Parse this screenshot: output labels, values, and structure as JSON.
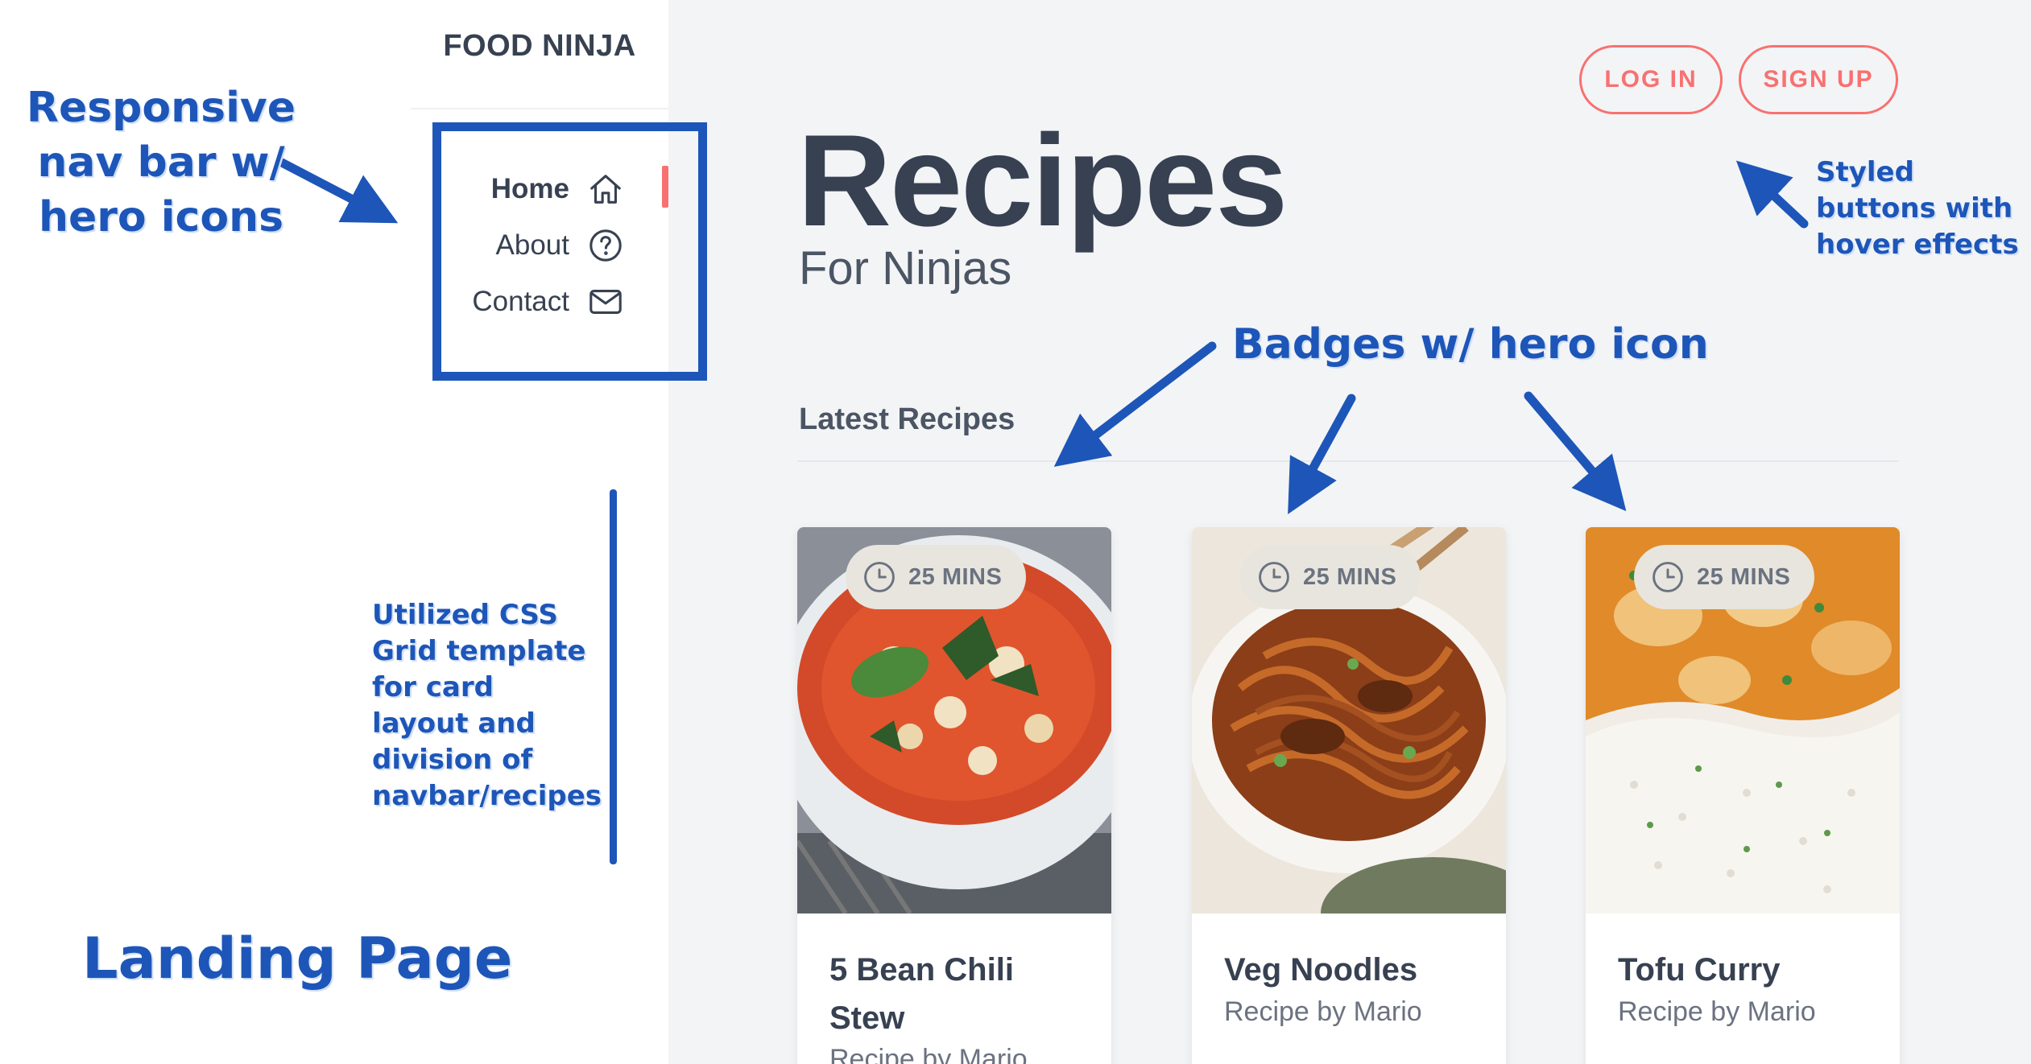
{
  "brand": "FOOD NINJA",
  "nav": {
    "items": [
      {
        "label": "Home",
        "icon": "home-icon",
        "active": true
      },
      {
        "label": "About",
        "icon": "question-icon",
        "active": false
      },
      {
        "label": "Contact",
        "icon": "mail-icon",
        "active": false
      }
    ]
  },
  "header": {
    "login_label": "LOG IN",
    "signup_label": "SIGN UP"
  },
  "hero": {
    "title": "Recipes",
    "subtitle": "For Ninjas"
  },
  "section": {
    "title": "Latest Recipes"
  },
  "recipes": [
    {
      "name": "5 Bean Chili Stew",
      "author": "Recipe by Mario",
      "badge": "25 MINS",
      "badge_icon": "clock-icon"
    },
    {
      "name": "Veg Noodles",
      "author": "Recipe by Mario",
      "badge": "25 MINS",
      "badge_icon": "clock-icon"
    },
    {
      "name": "Tofu Curry",
      "author": "Recipe by Mario",
      "badge": "25 MINS",
      "badge_icon": "clock-icon"
    }
  ],
  "annotations": {
    "nav": "Responsive nav bar w/ hero icons",
    "grid": "Utilized CSS Grid template for card layout and division of navbar/recipes",
    "landing": "Landing Page",
    "buttons": "Styled buttons with hover effects",
    "badges": "Badges w/ hero icon"
  },
  "colors": {
    "accent": "#f87171",
    "annotation": "#1d56b8",
    "main_background": "#f3f4f6",
    "text": "#374151"
  }
}
